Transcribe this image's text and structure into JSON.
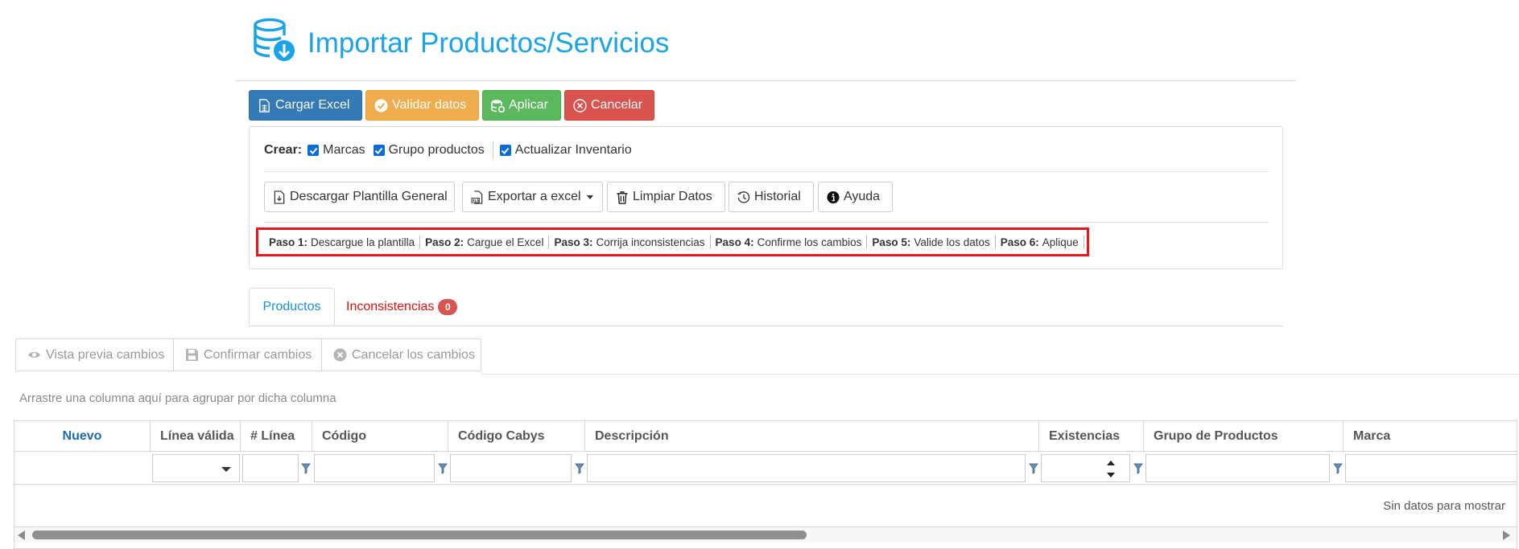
{
  "header": {
    "title": "Importar Productos/Servicios",
    "icon": "database-download-icon",
    "accent_color": "#1aa3e8"
  },
  "actions": {
    "cargar_excel": "Cargar Excel",
    "validar_datos": "Validar datos",
    "aplicar": "Aplicar",
    "cancelar": "Cancelar",
    "colors": {
      "cargar": "#337ab7",
      "validar": "#f0ad4e",
      "aplicar": "#5cb85c",
      "cancelar": "#d9534f"
    }
  },
  "options": {
    "crear_label": "Crear:",
    "marcas": {
      "label": "Marcas",
      "checked": true
    },
    "grupo_productos": {
      "label": "Grupo productos",
      "checked": true
    },
    "actualizar_inventario": {
      "label": "Actualizar Inventario",
      "checked": true
    }
  },
  "tools": {
    "descargar_plantilla": "Descargar Plantilla General",
    "exportar_excel": "Exportar a excel",
    "limpiar_datos": "Limpiar Datos",
    "historial": "Historial",
    "ayuda": "Ayuda"
  },
  "steps": [
    {
      "label": "Paso 1:",
      "text": "Descargue la plantilla"
    },
    {
      "label": "Paso 2:",
      "text": "Cargue el Excel"
    },
    {
      "label": "Paso 3:",
      "text": "Corrija inconsistencias"
    },
    {
      "label": "Paso 4:",
      "text": "Confirme los cambios"
    },
    {
      "label": "Paso 5:",
      "text": "Valide los datos"
    },
    {
      "label": "Paso 6:",
      "text": "Aplique"
    }
  ],
  "tabs": {
    "productos": "Productos",
    "inconsistencias": "Inconsistencias",
    "inconsistencias_count": "0"
  },
  "grid_toolbar": {
    "vista_previa": "Vista previa cambios",
    "confirmar": "Confirmar cambios",
    "cancelar": "Cancelar los cambios"
  },
  "group_hint": "Arrastre una columna aquí para agrupar por dicha columna",
  "grid": {
    "columns": [
      "Nuevo",
      "Línea válida",
      "# Línea",
      "Código",
      "Código Cabys",
      "Descripción",
      "Existencias",
      "Grupo de Productos",
      "Marca"
    ],
    "empty_text": "Sin datos para mostrar"
  }
}
